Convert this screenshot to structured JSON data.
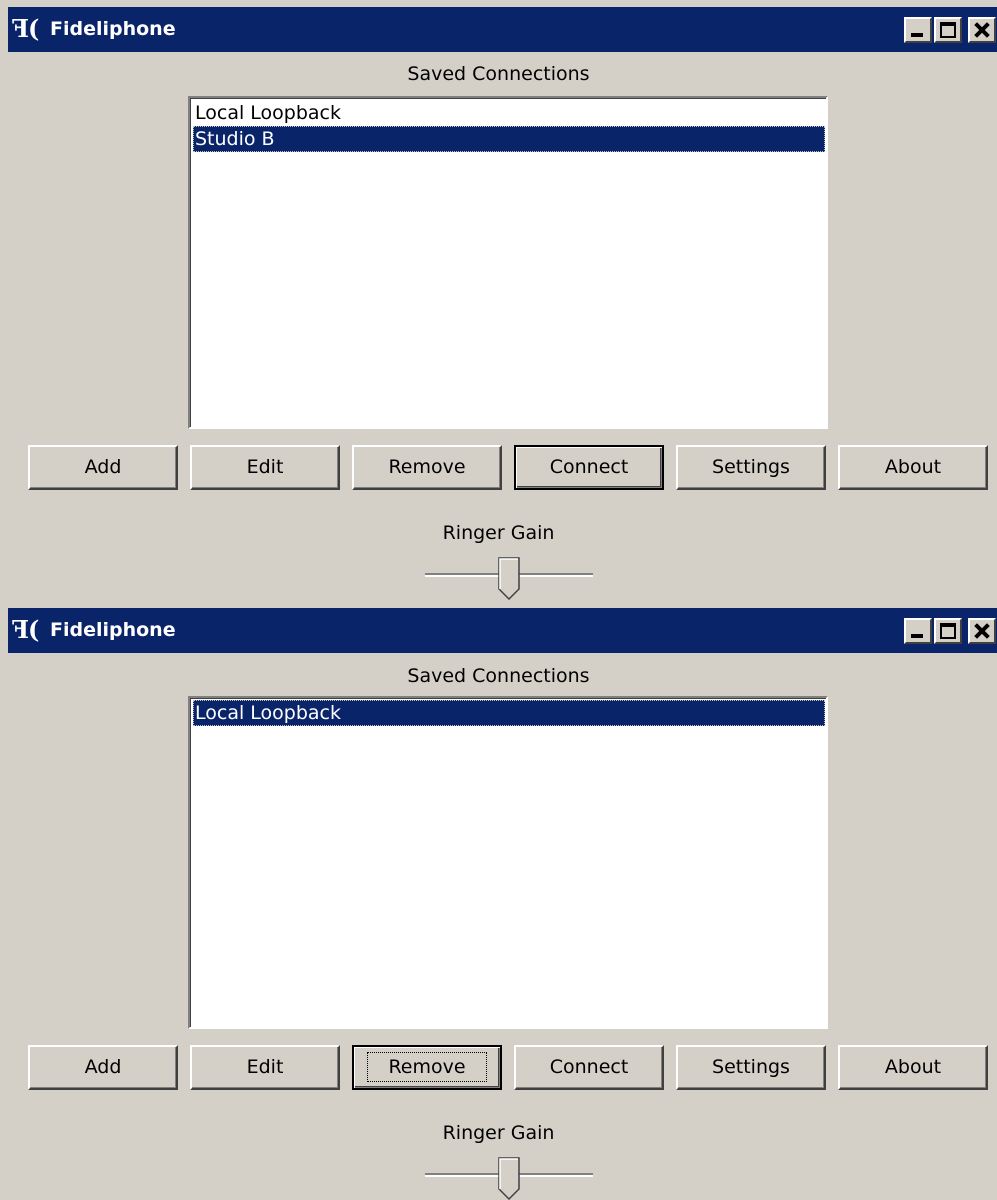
{
  "windows": [
    {
      "title": "Fideliphone",
      "app_icon": "fideliphone-icon",
      "saved_connections_label": "Saved Connections",
      "connections": [
        "Local Loopback",
        "Studio B"
      ],
      "selected_connection": "Studio B",
      "buttons": {
        "add": "Add",
        "edit": "Edit",
        "remove": "Remove",
        "connect": "Connect",
        "settings": "Settings",
        "about": "About"
      },
      "default_button": "Connect",
      "ringer_gain_label": "Ringer Gain",
      "ringer_gain_level": 0.5
    },
    {
      "title": "Fideliphone",
      "app_icon": "fideliphone-icon",
      "saved_connections_label": "Saved Connections",
      "connections": [
        "Local Loopback"
      ],
      "selected_connection": "Local Loopback",
      "buttons": {
        "add": "Add",
        "edit": "Edit",
        "remove": "Remove",
        "connect": "Connect",
        "settings": "Settings",
        "about": "About"
      },
      "default_button": "Remove",
      "focused_button": "Remove",
      "ringer_gain_label": "Ringer Gain",
      "ringer_gain_level": 0.5
    }
  ],
  "colors": {
    "titlebar": "#0a246a",
    "face": "#d4d0c8",
    "selection": "#0a246a"
  }
}
